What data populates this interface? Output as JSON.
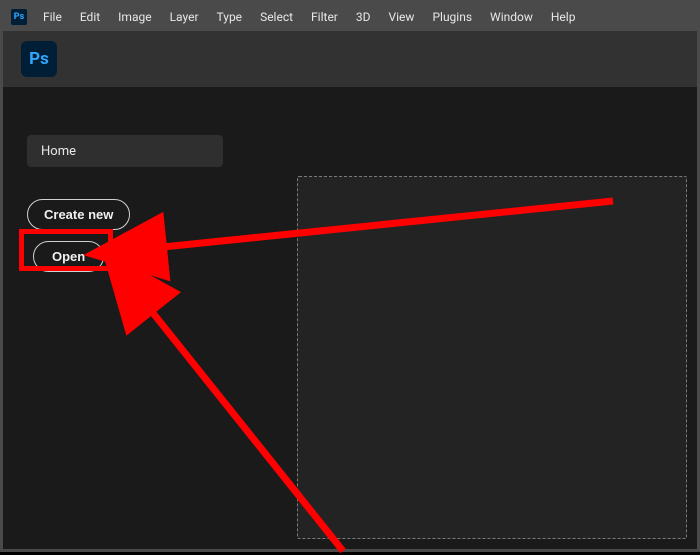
{
  "menubar": {
    "items": [
      "File",
      "Edit",
      "Image",
      "Layer",
      "Type",
      "Select",
      "Filter",
      "3D",
      "View",
      "Plugins",
      "Window",
      "Help"
    ]
  },
  "app": {
    "logo_text": "Ps"
  },
  "home": {
    "tab_label": "Home",
    "create_new_label": "Create new",
    "open_label": "Open"
  },
  "annotation": {
    "highlight_target": "open-button",
    "color": "#ff0000"
  }
}
